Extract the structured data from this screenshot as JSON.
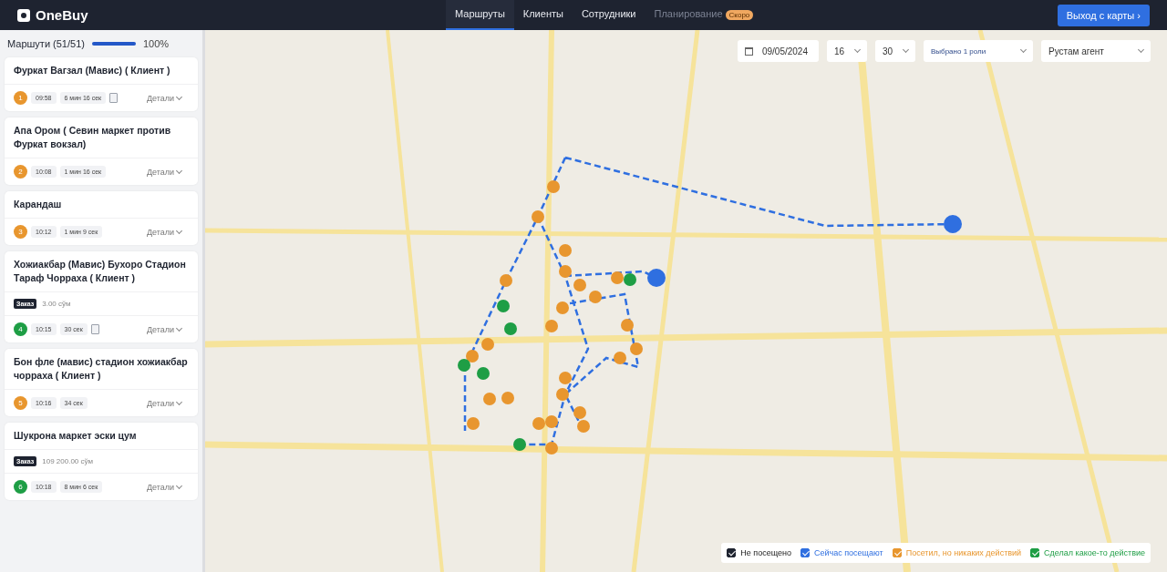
{
  "header": {
    "logo": "OneBuy",
    "nav": [
      {
        "label": "Маршруты",
        "selected": true
      },
      {
        "label": "Клиенты",
        "selected": false
      },
      {
        "label": "Сотрудники",
        "selected": false
      },
      {
        "label": "Планирование",
        "selected": false,
        "disabled": true,
        "badge": "Скоро"
      }
    ],
    "exit_button": "Выход с карты ›"
  },
  "sidebar": {
    "title": "Маршути (51/51)",
    "level": 1,
    "percent": "100%",
    "routes": [
      {
        "name": "Фуркат Вагзал (Мавис) ( Клиент )",
        "number": "1",
        "color": "#e8962e",
        "time": "09:58",
        "duration": "6 мин 16 сек",
        "receipt": true,
        "details": "Детали"
      },
      {
        "name": "Апа Ором ( Севин маркет против Фуркат вокзал)",
        "number": "2",
        "color": "#e8962e",
        "time": "10:08",
        "duration": "1 мин 16 сек",
        "receipt": false,
        "details": "Детали"
      },
      {
        "name": "Карандаш",
        "number": "3",
        "color": "#e8962e",
        "time": "10:12",
        "duration": "1 мин 9 сек",
        "receipt": false,
        "details": "Детали"
      },
      {
        "name": "Хожиакбар (Мавис) Бухоро Стадион Тараф Чорраха ( Клиент )",
        "order_tag": "Заказ",
        "order_amount": "3.00 сўм",
        "number": "4",
        "color": "#1e9e45",
        "time": "10:15",
        "duration": "30 сек",
        "receipt": true,
        "details": "Детали"
      },
      {
        "name": "Бон фле (мавис) стадион хожиакбар чорраха ( Клиент )",
        "number": "5",
        "color": "#e8962e",
        "time": "10:16",
        "duration": "34 сек",
        "receipt": false,
        "details": "Детали"
      },
      {
        "name": "Шукрона маркет эски цум",
        "order_tag": "Заказ",
        "order_amount": "109 200.00 сўм",
        "number": "6",
        "color": "#1e9e45",
        "time": "10:18",
        "duration": "8 мин 6 сек",
        "receipt": false,
        "details": "Детали"
      }
    ]
  },
  "filters": {
    "date": "09/05/2024",
    "hour": "16",
    "minute": "30",
    "roles": "Выбрано 1 роли",
    "agent": "Рустам агент"
  },
  "legend": [
    {
      "label": "Не посещено",
      "checked": true,
      "color": "#1f2430"
    },
    {
      "label": "Сейчас посещают",
      "checked": true,
      "color": "#2f6fe0"
    },
    {
      "label": "Посетил, но никаких действий",
      "checked": true,
      "color": "#e8962e"
    },
    {
      "label": "Сделал какое-то действие",
      "checked": true,
      "color": "#1e9e45"
    }
  ]
}
